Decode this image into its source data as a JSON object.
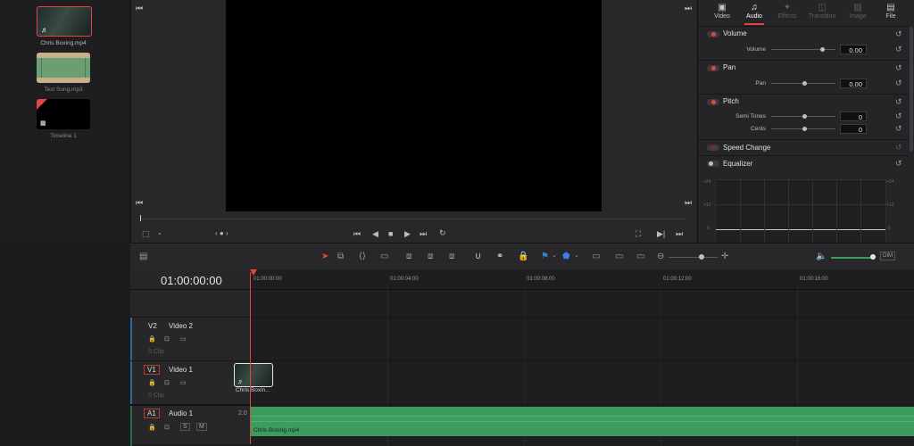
{
  "media_pool": {
    "clips": [
      {
        "name": "Chris Boxing.mp4"
      },
      {
        "name": "Test Song.mp3"
      },
      {
        "name": "Timeline 1"
      }
    ]
  },
  "inspector": {
    "tabs": [
      {
        "label": "Video",
        "icon": "video-icon",
        "active": false
      },
      {
        "label": "Audio",
        "icon": "music-note-icon",
        "active": true
      },
      {
        "label": "Effects",
        "icon": "effects-icon",
        "active": false
      },
      {
        "label": "Transition",
        "icon": "transition-icon",
        "active": false
      },
      {
        "label": "Image",
        "icon": "image-icon",
        "active": false
      },
      {
        "label": "File",
        "icon": "file-icon",
        "active": false
      }
    ],
    "volume": {
      "title": "Volume",
      "param_label": "Volume",
      "value": "0.00"
    },
    "pan": {
      "title": "Pan",
      "param_label": "Pan",
      "value": "0.00"
    },
    "pitch": {
      "title": "Pitch",
      "semitones_label": "Semi Tones",
      "semitones_value": "0",
      "cents_label": "Cents",
      "cents_value": "0"
    },
    "speed_change": {
      "title": "Speed Change"
    },
    "equalizer": {
      "title": "Equalizer",
      "y_labels": [
        "+24",
        "+12",
        "0"
      ]
    }
  },
  "timeline": {
    "timecode": "01:00:00:00",
    "ruler": [
      "01:00:00:00",
      "01:00:04:00",
      "01:00:08:00",
      "01:00:12:00",
      "01:00:16:00"
    ],
    "tracks": [
      {
        "id": "V2",
        "name": "Video 2",
        "clip_count": "0 Clip"
      },
      {
        "id": "V1",
        "name": "Video 1",
        "clip_count": "0 Clip"
      },
      {
        "id": "A1",
        "name": "Audio 1",
        "channel": "2.0",
        "solo": "S",
        "mute": "M"
      }
    ],
    "video_clip": {
      "label": "Chris Boxin..."
    },
    "audio_clip": {
      "label": "Chris Boxing.mp4"
    },
    "colors": {
      "playhead": "#e0473d",
      "audio_clip": "#3d9b5e"
    }
  }
}
